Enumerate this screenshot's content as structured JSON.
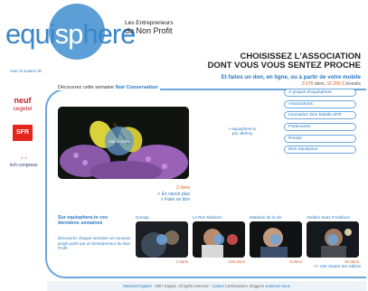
{
  "logo": {
    "part1": "equi",
    "part2": "sp",
    "part3": "here"
  },
  "tagline": {
    "line1": "Les Entrepreneurs",
    "line2": "du Non Profit"
  },
  "headline": {
    "line1": "CHOISISSEZ L'ASSOCIATION",
    "line2": "DONT VOUS VOUS SENTEZ PROCHE"
  },
  "subline": "Et faites un don, en ligne, ou à partir de votre mobile",
  "counters": {
    "dons_count": "3 676",
    "dons_label": "dons,",
    "invest_amount": "16 256 €",
    "invest_label": "investis"
  },
  "sponsors": {
    "caption": "Avec le soutien de",
    "neuf": {
      "name": "neuf",
      "sub": "cegetel"
    },
    "sfr": "SFR",
    "rich": "rich congress"
  },
  "week": {
    "prefix": "Découvrez cette semaine",
    "name": "Noé Conservation"
  },
  "video": {
    "play_label": "Voir la vidéo"
  },
  "video_meta": {
    "dons": "2 dons",
    "more": "> En savoir plus",
    "donate": "> Faire un don"
  },
  "url_note": {
    "line1": "> equisphere.tv",
    "line2": "par Jérémy"
  },
  "menu": [
    "À propos d'equisphere",
    "Associations",
    "Innovation Don Mobile SFR",
    "Partenaires",
    "Presse",
    "Mon equispace"
  ],
  "latest": {
    "title": "Sur equisphere.tv ces dernières semaines",
    "desc": "Découvrez chaque semaine un nouveau projet porté par un Entrepreneur du Non Profit"
  },
  "thumbs": [
    {
      "title": "Gorsap",
      "dons": "4 dons"
    },
    {
      "title": "Le Rire Médecin",
      "dons": "146 dons"
    },
    {
      "title": "Matelots de la Vie",
      "dons": "5 dons"
    },
    {
      "title": "Ateliers Sans Frontières",
      "dons": "45 dons"
    }
  ],
  "see_all": ">> Voir toutes les vidéos",
  "footer": {
    "legal": "Mentions légales",
    "copy": "- 2007 Equipé. All rights reserved -",
    "contact": "contact",
    "rest": "| webmasters, bloggers",
    "share": "soutenez-nous"
  },
  "colors": {
    "brand_blue": "#2a79c4",
    "frame_blue": "#6ba6dc",
    "orange": "#e05a1d",
    "sfr_red": "#e4261c"
  }
}
